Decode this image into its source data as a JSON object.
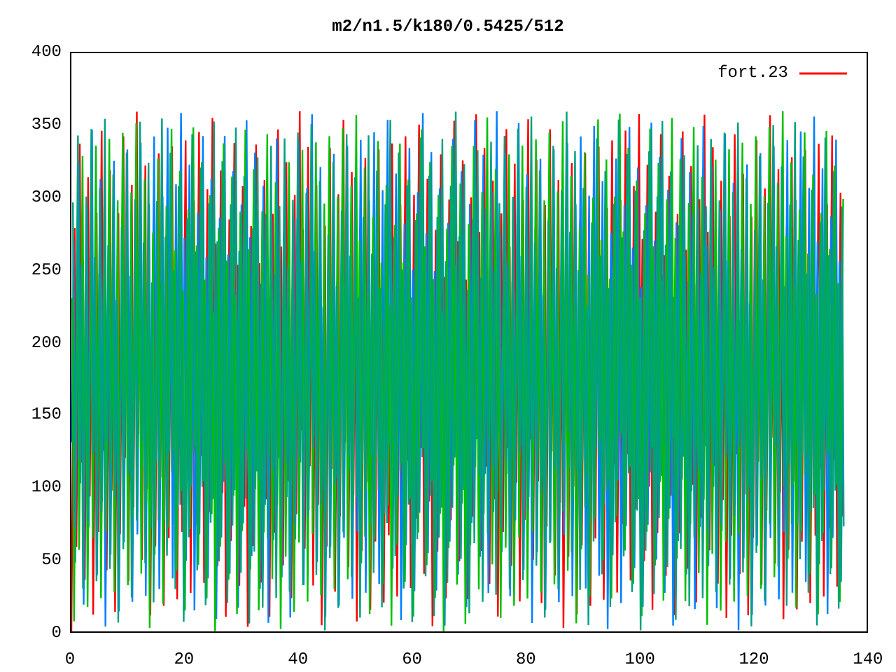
{
  "title": "m2/n1.5/k180/0.5425/512",
  "legend": {
    "label": "fort.23",
    "color": "#ff0000"
  },
  "y_tick_labels": [
    "400",
    "350",
    "300",
    "250",
    "200",
    "150",
    "100",
    "50",
    "0"
  ],
  "x_tick_labels": [
    "0",
    "20",
    "40",
    "60",
    "80",
    "100",
    "120",
    "140"
  ]
}
